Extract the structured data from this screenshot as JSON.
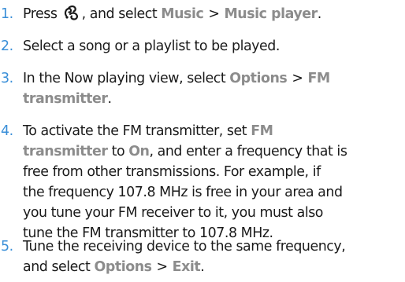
{
  "steps": [
    {
      "num": "1.",
      "pre": "Press",
      "post": ", and select",
      "item1": "Music",
      "sep": ">",
      "item2": "Music player",
      "post2": ".",
      "icon": "menu-key-icon"
    },
    {
      "num": "2.",
      "text": "Select a song or a playlist to be played."
    },
    {
      "num": "3.",
      "pre": "In the Now playing view, select",
      "item1": "Options",
      "sep": ">",
      "item2a": "FM",
      "item2b": "transmitter",
      "post": "."
    },
    {
      "num": "4.",
      "line1_pre": "To activate the FM transmitter, set",
      "hl1a": "FM",
      "hl1b": "transmitter",
      "mid1": "to",
      "hl2": "On",
      "line2_post": ", and enter a frequency that is",
      "line3": "free from other transmissions. For example, if",
      "line4": "the frequency 107.8 MHz is free in your area and",
      "line5": "you tune your FM receiver to it, you must also",
      "line6": "tune the FM transmitter to 107.8 MHz."
    },
    {
      "num": "5.",
      "line1": "Tune the receiving device to the same frequency,",
      "line2_pre": "and select",
      "item1": "Options",
      "sep": ">",
      "item2": "Exit",
      "post": "."
    }
  ],
  "colors": {
    "number": "#3a8fd8",
    "highlight": "#8c8c8c",
    "text": "#1a1a1a"
  }
}
